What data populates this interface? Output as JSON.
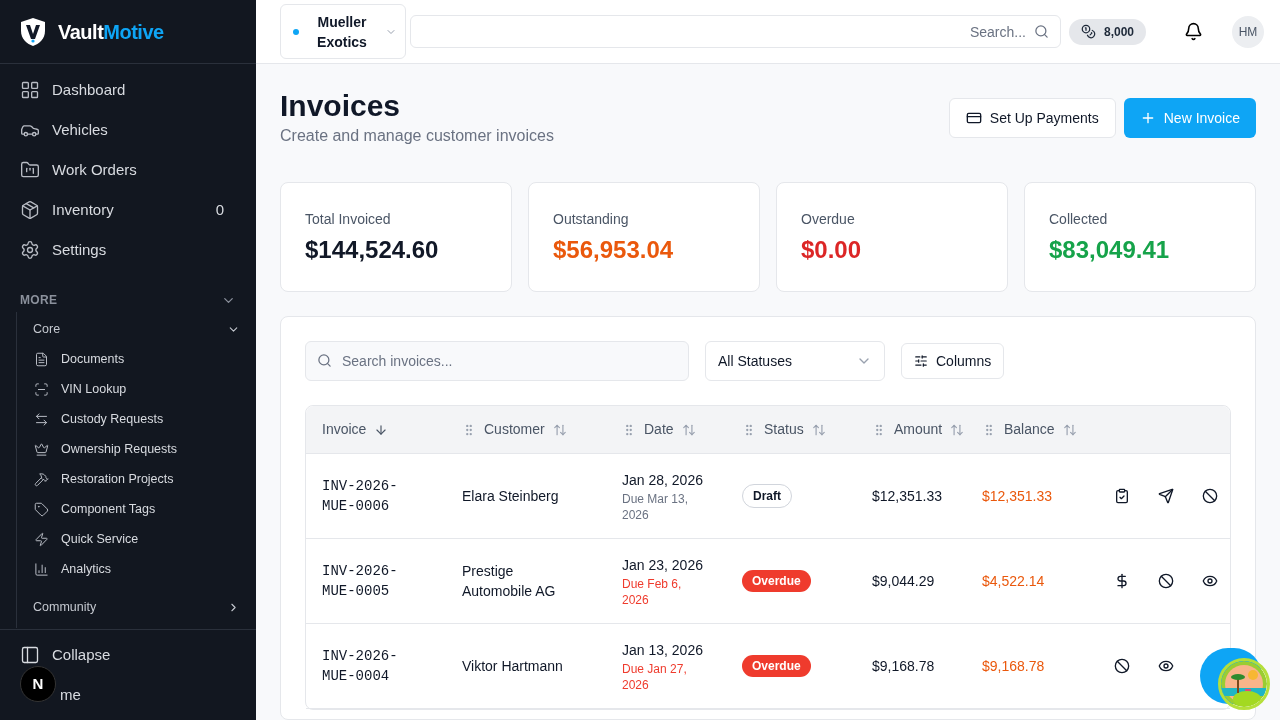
{
  "brand": {
    "first": "Vault",
    "second": "Motive"
  },
  "nav": [
    {
      "label": "Dashboard"
    },
    {
      "label": "Vehicles"
    },
    {
      "label": "Work Orders"
    },
    {
      "label": "Inventory",
      "count": "0"
    },
    {
      "label": "Settings"
    }
  ],
  "more": {
    "label": "MORE",
    "expanded": true,
    "groups": [
      {
        "label": "Core",
        "expanded": true,
        "items": [
          {
            "label": "Documents"
          },
          {
            "label": "VIN Lookup"
          },
          {
            "label": "Custody Requests"
          },
          {
            "label": "Ownership Requests"
          },
          {
            "label": "Restoration Projects"
          },
          {
            "label": "Component Tags"
          },
          {
            "label": "Quick Service"
          },
          {
            "label": "Analytics"
          }
        ]
      },
      {
        "label": "Community",
        "expanded": false
      }
    ]
  },
  "footer": [
    {
      "label": "Collapse"
    },
    {
      "label": "me"
    }
  ],
  "dev_badge": "N",
  "topbar": {
    "workspace": "Mueller Exotics",
    "search": {
      "placeholder": "Search..."
    },
    "credits": "8,000",
    "avatar": "HM"
  },
  "page": {
    "title": "Invoices",
    "subtitle": "Create and manage customer invoices",
    "buttons": [
      {
        "label": "Set Up Payments",
        "kind": "secondary"
      },
      {
        "label": "New Invoice",
        "kind": "primary"
      }
    ]
  },
  "stats": [
    {
      "label": "Total Invoiced",
      "value": "$144,524.60",
      "color": "#111827"
    },
    {
      "label": "Outstanding",
      "value": "$56,953.04",
      "color": "#ea580c"
    },
    {
      "label": "Overdue",
      "value": "$0.00",
      "color": "#dc2626"
    },
    {
      "label": "Collected",
      "value": "$83,049.41",
      "color": "#16a34a"
    }
  ],
  "filters": {
    "search": {
      "placeholder": "Search invoices..."
    },
    "status": "All Statuses",
    "columns": "Columns"
  },
  "table": {
    "columns": [
      {
        "label": "Invoice",
        "sorted": true
      },
      {
        "label": "Customer",
        "sorted": false
      },
      {
        "label": "Date",
        "sorted": false
      },
      {
        "label": "Status",
        "sorted": false
      },
      {
        "label": "Amount",
        "sorted": false
      },
      {
        "label": "Balance",
        "sorted": false
      }
    ],
    "rows": [
      {
        "invoice": "INV-2026-MUE-0006",
        "customer": "Elara Steinberg",
        "date": "Jan 28, 2026",
        "due": "Due Mar 13, 2026",
        "status": {
          "label": "Draft",
          "kind": "draft"
        },
        "amount": "$12,351.33",
        "balance": "$12,351.33",
        "actions": [
          {
            "kind": "clipboard"
          },
          {
            "kind": "send"
          },
          {
            "kind": "ban"
          }
        ]
      },
      {
        "invoice": "INV-2026-MUE-0005",
        "customer": "Prestige Automobile AG",
        "date": "Jan 23, 2026",
        "due": "Due Feb 6, 2026",
        "status": {
          "label": "Overdue",
          "kind": "overdue"
        },
        "amount": "$9,044.29",
        "balance": "$4,522.14",
        "actions": [
          {
            "kind": "dollar"
          },
          {
            "kind": "ban"
          },
          {
            "kind": "eye"
          }
        ]
      },
      {
        "invoice": "INV-2026-MUE-0004",
        "customer": "Viktor Hartmann",
        "date": "Jan 13, 2026",
        "due": "Due Jan 27, 2026",
        "status": {
          "label": "Overdue",
          "kind": "overdue"
        },
        "amount": "$9,168.78",
        "balance": "$9,168.78",
        "actions": [
          {
            "kind": "ban"
          },
          {
            "kind": "eye"
          }
        ]
      }
    ]
  }
}
